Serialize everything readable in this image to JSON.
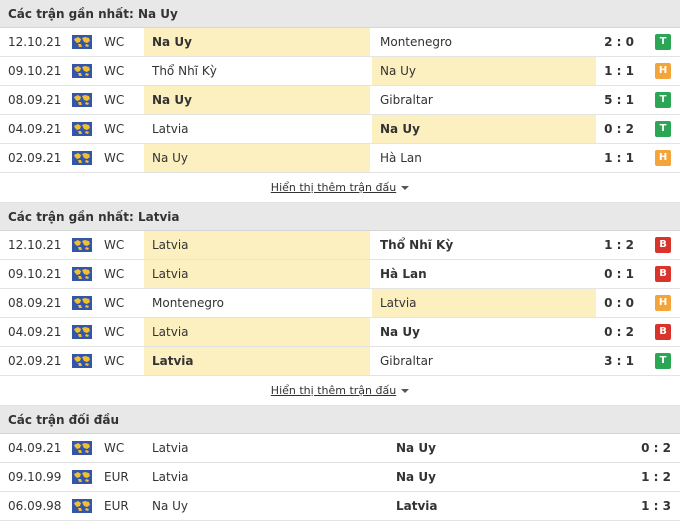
{
  "sections": [
    {
      "title": "Các trận gần nhất: Na Uy",
      "show_more": "Hiển thị thêm trận đấu",
      "rows": [
        {
          "date": "12.10.21",
          "comp": "WC",
          "home": "Na Uy",
          "away": "Montenegro",
          "score": "2 : 0",
          "result": "T",
          "hl": "home",
          "bold": "home"
        },
        {
          "date": "09.10.21",
          "comp": "WC",
          "home": "Thổ Nhĩ Kỳ",
          "away": "Na Uy",
          "score": "1 : 1",
          "result": "H",
          "hl": "away",
          "bold": ""
        },
        {
          "date": "08.09.21",
          "comp": "WC",
          "home": "Na Uy",
          "away": "Gibraltar",
          "score": "5 : 1",
          "result": "T",
          "hl": "home",
          "bold": "home"
        },
        {
          "date": "04.09.21",
          "comp": "WC",
          "home": "Latvia",
          "away": "Na Uy",
          "score": "0 : 2",
          "result": "T",
          "hl": "away",
          "bold": "away"
        },
        {
          "date": "02.09.21",
          "comp": "WC",
          "home": "Na Uy",
          "away": "Hà Lan",
          "score": "1 : 1",
          "result": "H",
          "hl": "home",
          "bold": ""
        }
      ]
    },
    {
      "title": "Các trận gần nhất: Latvia",
      "show_more": "Hiển thị thêm trận đấu",
      "rows": [
        {
          "date": "12.10.21",
          "comp": "WC",
          "home": "Latvia",
          "away": "Thổ Nhĩ Kỳ",
          "score": "1 : 2",
          "result": "B",
          "hl": "home",
          "bold": "away"
        },
        {
          "date": "09.10.21",
          "comp": "WC",
          "home": "Latvia",
          "away": "Hà Lan",
          "score": "0 : 1",
          "result": "B",
          "hl": "home",
          "bold": "away"
        },
        {
          "date": "08.09.21",
          "comp": "WC",
          "home": "Montenegro",
          "away": "Latvia",
          "score": "0 : 0",
          "result": "H",
          "hl": "away",
          "bold": ""
        },
        {
          "date": "04.09.21",
          "comp": "WC",
          "home": "Latvia",
          "away": "Na Uy",
          "score": "0 : 2",
          "result": "B",
          "hl": "home",
          "bold": "away"
        },
        {
          "date": "02.09.21",
          "comp": "WC",
          "home": "Latvia",
          "away": "Gibraltar",
          "score": "3 : 1",
          "result": "T",
          "hl": "home",
          "bold": "home"
        }
      ]
    }
  ],
  "h2h": {
    "title": "Các trận đối đầu",
    "rows": [
      {
        "date": "04.09.21",
        "comp": "WC",
        "home": "Latvia",
        "away": "Na Uy",
        "score": "0 : 2",
        "bold": "away"
      },
      {
        "date": "09.10.99",
        "comp": "EUR",
        "home": "Latvia",
        "away": "Na Uy",
        "score": "1 : 2",
        "bold": "away"
      },
      {
        "date": "06.09.98",
        "comp": "EUR",
        "home": "Na Uy",
        "away": "Latvia",
        "score": "1 : 3",
        "bold": "away"
      }
    ]
  },
  "colors": {
    "win": "#2aa655",
    "draw": "#f3a43b",
    "loss": "#d9342b",
    "highlight": "#fdf0c0"
  },
  "icons": {
    "competition": "world-map-flag-icon",
    "show_more": "caret-down-icon"
  }
}
